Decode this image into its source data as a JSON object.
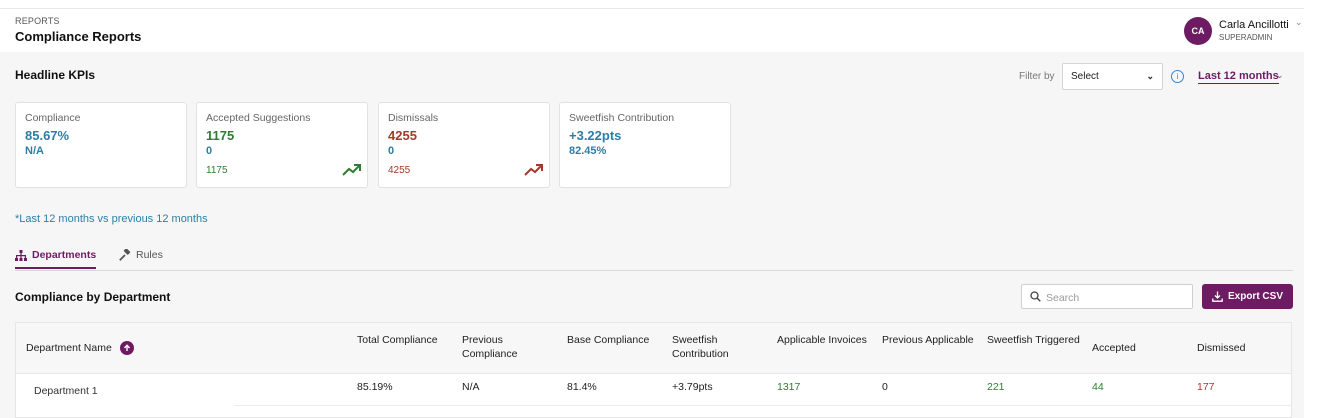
{
  "header": {
    "breadcrumb": "REPORTS",
    "title": "Compliance Reports",
    "user": {
      "initials": "CA",
      "name": "Carla Ancillotti",
      "role": "SUPERADMIN"
    }
  },
  "kpis": {
    "heading": "Headline KPIs",
    "filter_label": "Filter by",
    "filter_select": "Select",
    "period": "Last 12 months",
    "cards": [
      {
        "label": "Compliance",
        "value": "85.67%",
        "delta": "N/A",
        "sub": ""
      },
      {
        "label": "Accepted Suggestions",
        "value": "1175",
        "delta": "0",
        "sub": "1175",
        "trend": "up"
      },
      {
        "label": "Dismissals",
        "value": "4255",
        "delta": "0",
        "sub": "4255",
        "trend": "up"
      },
      {
        "label": "Sweetfish Contribution",
        "value": "+3.22pts",
        "delta": "82.45%",
        "sub": ""
      }
    ],
    "note": "*Last 12 months vs previous 12 months"
  },
  "tabs": [
    {
      "label": "Departments",
      "icon": "sitemap-icon",
      "active": true
    },
    {
      "label": "Rules",
      "icon": "gavel-icon",
      "active": false
    }
  ],
  "section": {
    "title": "Compliance by Department",
    "search_placeholder": "Search",
    "export_label": "Export CSV"
  },
  "table": {
    "columns": [
      "Department Name",
      "Total Compliance",
      "Previous Compliance",
      "Base Compliance",
      "Sweetfish Contribution",
      "Applicable Invoices",
      "Previous Applicable",
      "Sweetfish Triggered",
      "Accepted",
      "Dismissed"
    ],
    "rows": [
      [
        "Department 1",
        "85.19%",
        "N/A",
        "81.4%",
        "+3.79pts",
        "1317",
        "0",
        "221",
        "44",
        "177"
      ]
    ]
  },
  "colors": {
    "brand": "#6d1b63",
    "value_blue": "#2d7ea6",
    "positive": "#2e7d32",
    "negative": "#a23b2a"
  }
}
